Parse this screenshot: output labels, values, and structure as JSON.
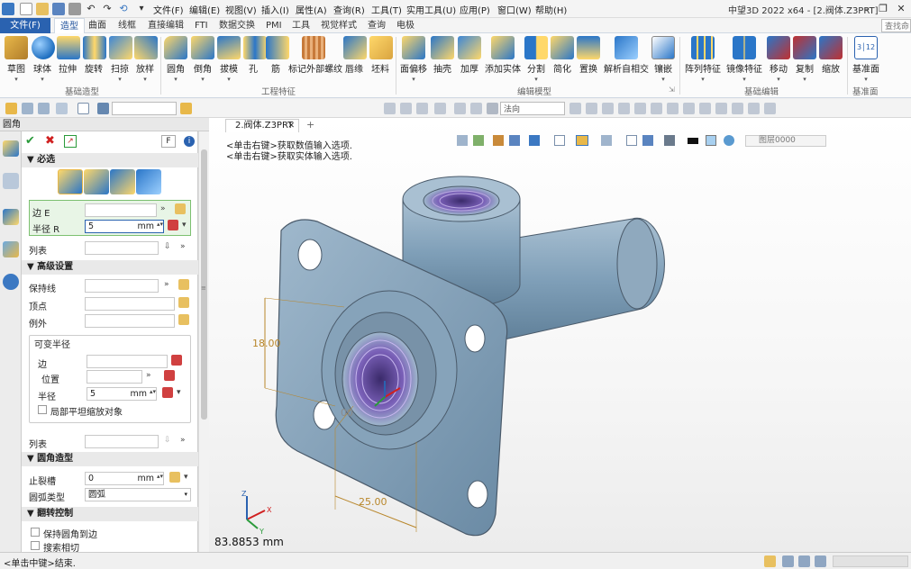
{
  "window": {
    "title": "中望3D 2022 x64 - [2.阀体.Z3PRT]",
    "search_placeholder": "查找命"
  },
  "menu": [
    "文件(F)",
    "编辑(E)",
    "视图(V)",
    "插入(I)",
    "属性(A)",
    "查询(R)",
    "工具(T)",
    "实用工具(U)",
    "应用(P)",
    "窗口(W)",
    "帮助(H)"
  ],
  "ribbon_tabs": [
    "文件(F)",
    "造型",
    "曲面",
    "线框",
    "直接编辑",
    "FTI",
    "数据交换",
    "PMI",
    "工具",
    "视觉样式",
    "查询",
    "电极"
  ],
  "active_tab": "造型",
  "ribbon": {
    "basic_modeling": {
      "label": "基础造型",
      "tools": [
        "草图",
        "球体",
        "拉伸",
        "旋转",
        "扫掠",
        "放样"
      ]
    },
    "feature_engineering": {
      "label": "工程特征",
      "tools": [
        "圆角",
        "倒角",
        "拔模",
        "孔",
        "筋",
        "标记外部螺纹",
        "唇缘",
        "坯料"
      ]
    },
    "edit_model": {
      "label": "编辑模型",
      "tools": [
        "面偏移",
        "抽壳",
        "加厚",
        "添加实体",
        "分割",
        "简化",
        "置换",
        "解析自相交",
        "镶嵌"
      ]
    },
    "basic_edit": {
      "label": "基础编辑",
      "tools": [
        "阵列特征",
        "镜像特征",
        "移动",
        "复制",
        "缩放"
      ]
    },
    "datum": {
      "label": "基准面",
      "tools": [
        "基准面"
      ]
    }
  },
  "toolbar2": {
    "filter_value": "",
    "direction_value": "法向",
    "layer_value": "图层0000"
  },
  "panel": {
    "title": "圆角",
    "buttons": {
      "f": "F",
      "info": "i"
    },
    "sections": {
      "required": "必选",
      "advanced": "高级设置",
      "variable": "可变半径",
      "fillet_shape": "圆角造型",
      "flip": "翻转控制"
    },
    "required": {
      "edge_label": "边 E",
      "edge_value": "",
      "radius_label": "半径 R",
      "radius_value": "5",
      "unit": "mm",
      "list_label": "列表"
    },
    "advanced": {
      "keep_line": "保持线",
      "vertex": "顶点",
      "exception": "例外"
    },
    "variable": {
      "edge": "边",
      "position": "位置",
      "radius": "半径",
      "radius_value": "5",
      "unit": "mm",
      "flatten": "局部平坦缩放对象"
    },
    "list2": "列表",
    "shape": {
      "relief_label": "止裂槽",
      "relief_value": "0",
      "unit": "mm",
      "arc_type_label": "圆弧类型",
      "arc_type_value": "圆弧"
    },
    "flip": {
      "keep_fillet": "保持圆角到边",
      "search_tangent": "搜索相切"
    }
  },
  "document_tab": "2.阀体.Z3PRT",
  "hints": [
    "<单击右键>获取数值输入选项.",
    "<单击右键>获取实体输入选项."
  ],
  "dimensions": {
    "vertical": "18.00",
    "horizontal": "25.00",
    "radius_tag": "00"
  },
  "measure": "83.8853 mm",
  "status": "<单击中键>结束.",
  "colors": {
    "accent": "#2a62b0",
    "part": "#7f9fb8",
    "part_dark": "#5f7f98",
    "thread": "#7a60b8",
    "dimension": "#b8862a"
  }
}
